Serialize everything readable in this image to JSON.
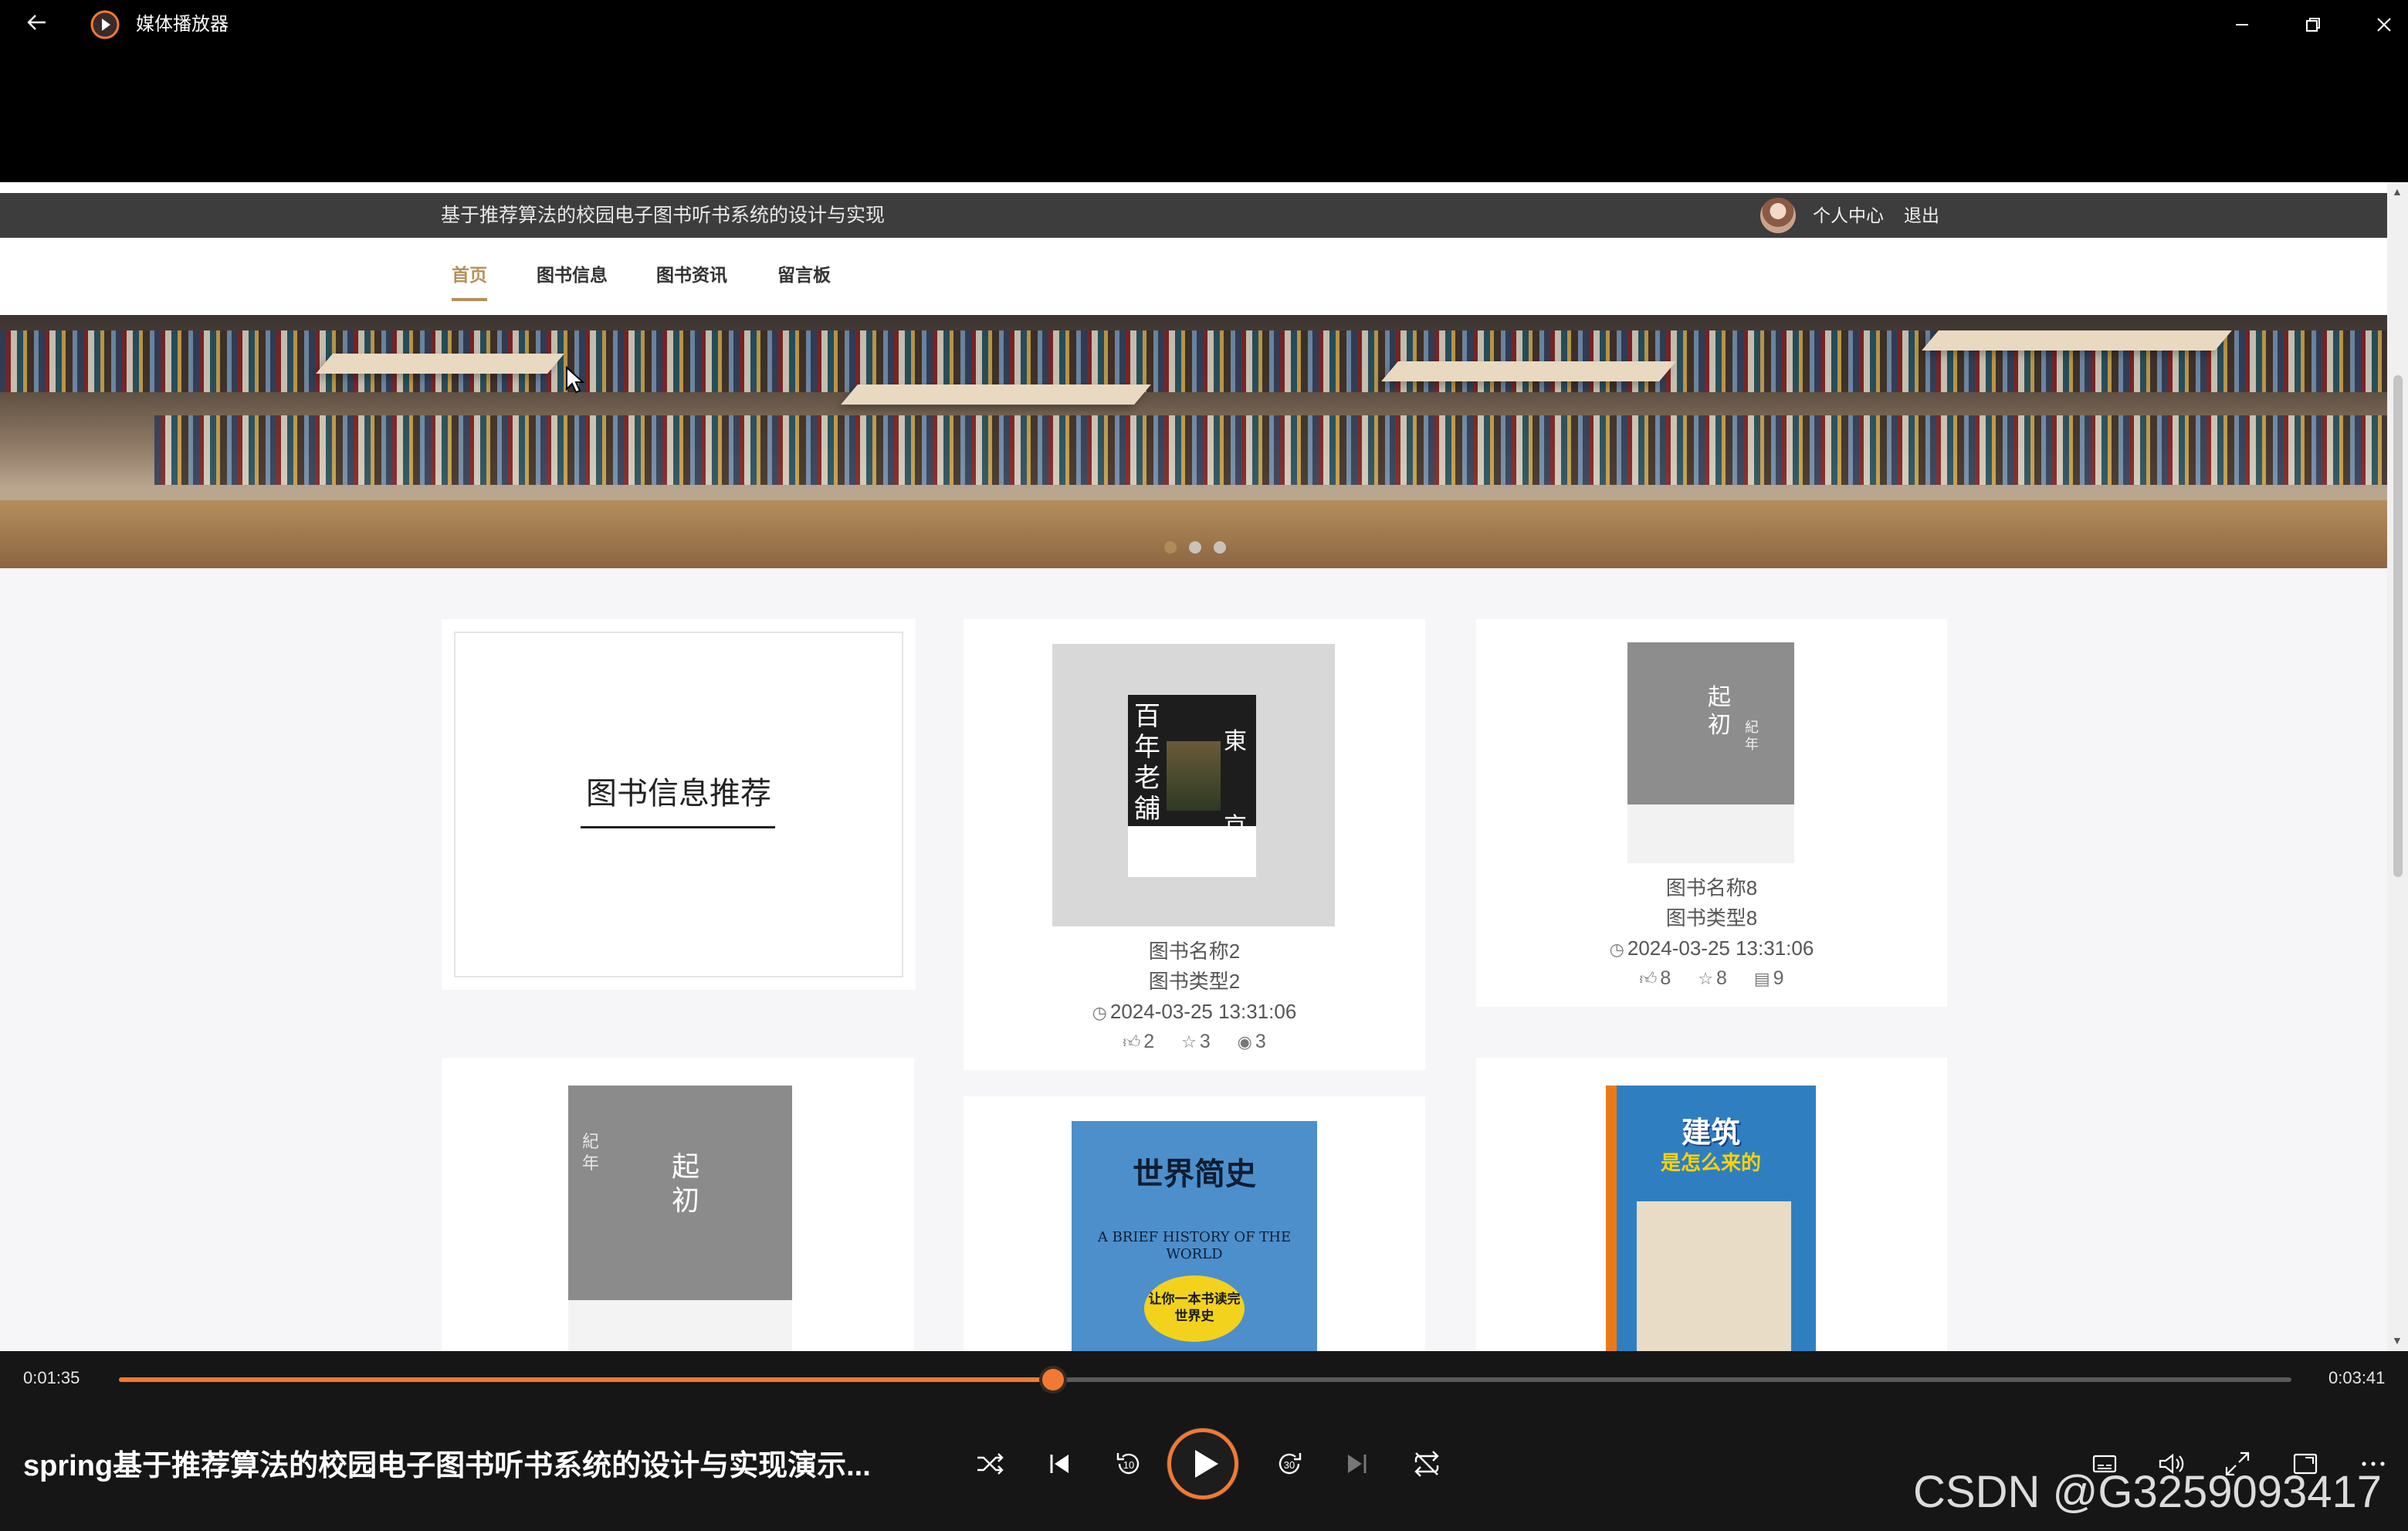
{
  "window": {
    "app_title": "媒体播放器",
    "back_icon": "arrow-left-icon",
    "minimize_icon": "minimize-icon",
    "restore_icon": "restore-icon",
    "close_icon": "close-icon"
  },
  "site": {
    "title": "基于推荐算法的校园电子图书听书系统的设计与实现",
    "user": {
      "personal_center": "个人中心",
      "logout": "退出"
    },
    "nav": [
      {
        "label": "首页",
        "active": true
      },
      {
        "label": "图书信息",
        "active": false
      },
      {
        "label": "图书资讯",
        "active": false
      },
      {
        "label": "留言板",
        "active": false
      }
    ],
    "banner": {
      "slides": 3,
      "active_slide": 1
    },
    "featured": {
      "title": "图书信息推荐"
    },
    "books": [
      {
        "name": "图书名称2",
        "type": "图书类型2",
        "time": "2024-03-25 13:31:06",
        "likes": "2",
        "favorites": "3",
        "views": "3",
        "cover_text": [
          "百年老舖",
          "東京"
        ]
      },
      {
        "name": "图书名称8",
        "type": "图书类型8",
        "time": "2024-03-25 13:31:06",
        "likes": "8",
        "favorites": "8",
        "views": "9",
        "cover_text": [
          "起初",
          "紀年"
        ]
      },
      {
        "cover_text": [
          "起初",
          "紀年"
        ]
      },
      {
        "cover_text": [
          "世界简史",
          "A BRIEF HISTORY OF THE WORLD",
          "让你一本书读完世界史"
        ]
      },
      {
        "cover_text": [
          "建筑",
          "是怎么来的"
        ]
      }
    ]
  },
  "player": {
    "current_time": "0:01:35",
    "total_time": "0:03:41",
    "progress": 0.43,
    "video_title": "spring基于推荐算法的校园电子图书听书系统的设计与实现演示...",
    "skip_back_label": "10",
    "skip_forward_label": "30",
    "watermark": "CSDN @G3259093417",
    "accent_color": "#f07a35"
  }
}
